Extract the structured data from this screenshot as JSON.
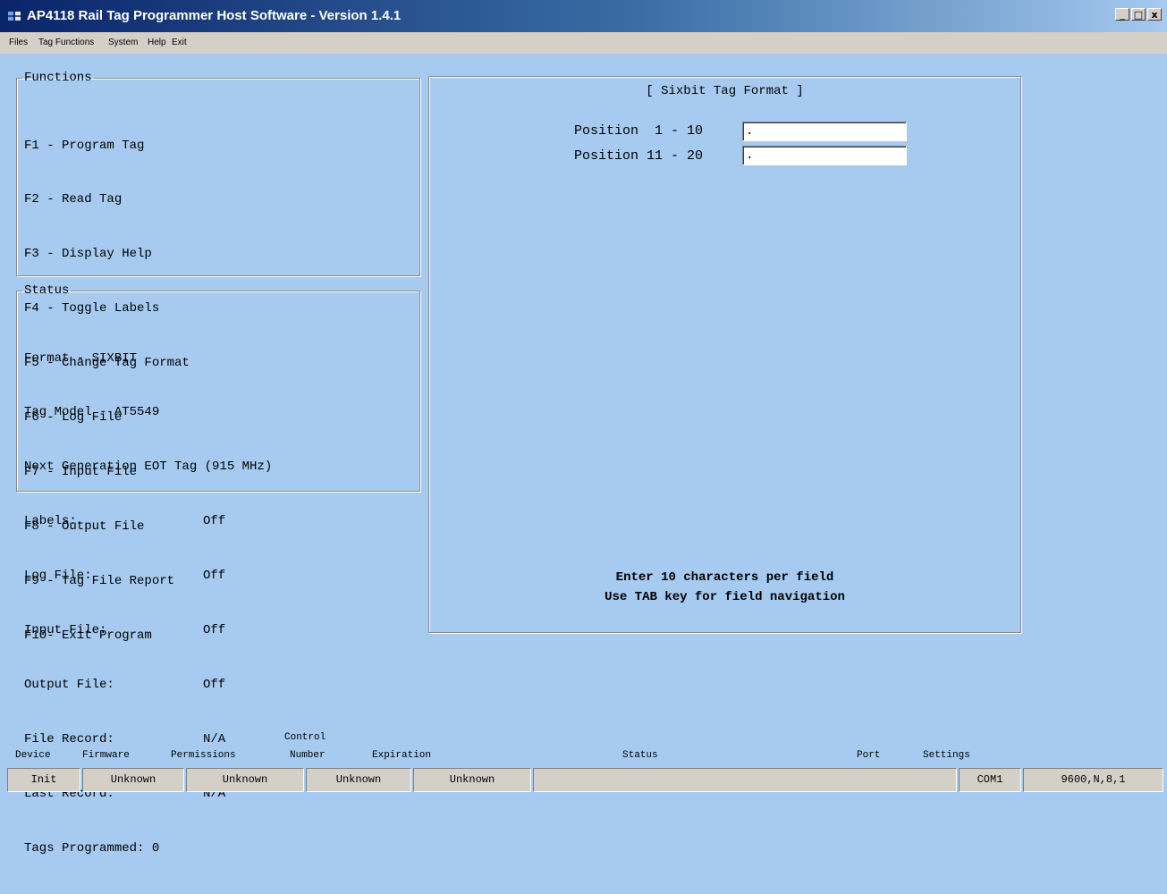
{
  "window": {
    "title": "AP4118 Rail Tag Programmer Host Software - Version 1.4.1",
    "minimize": "_",
    "maximize": "□",
    "close": "x"
  },
  "menu": [
    "Files",
    "Tag Functions",
    "System",
    "Help",
    "Exit"
  ],
  "functions": {
    "legend": "Functions",
    "items": [
      "F1 - Program Tag",
      "F2 - Read Tag",
      "F3 - Display Help",
      "F4 - Toggle Labels",
      "F5 - Change Tag Format",
      "F6 - Log File",
      "F7 - Input File",
      "F8 - Output File",
      "F9 - Tag File Report",
      "F10- Exit Program"
    ]
  },
  "status_panel": {
    "legend": "Status",
    "format": "Format - SIXBIT",
    "tag_model": "Tag Model - AT5549",
    "generation": "Next Generation EOT Tag (915 MHz)",
    "rows": [
      {
        "label": "Labels:",
        "value": "Off"
      },
      {
        "label": "Log File:",
        "value": "Off"
      },
      {
        "label": "Input File:",
        "value": "Off"
      },
      {
        "label": "Output File:",
        "value": "Off"
      },
      {
        "label": "File Record:",
        "value": "N/A"
      },
      {
        "label": "Last Record:",
        "value": "N/A"
      }
    ],
    "tags_programmed": "Tags Programmed: 0"
  },
  "tag_format": {
    "title": "[ Sixbit Tag Format ]",
    "fields": [
      {
        "label": "Position  1 - 10",
        "value": "."
      },
      {
        "label": "Position 11 - 20",
        "value": "."
      }
    ],
    "note1": "Enter 10 characters per field",
    "note2": "Use TAB key for field navigation"
  },
  "statusbar": {
    "headers": {
      "device": "Device",
      "firmware": "Firmware",
      "permissions": "Permissions",
      "control": "Control",
      "number": "Number",
      "expiration": "Expiration",
      "status": "Status",
      "port": "Port",
      "settings": "Settings"
    },
    "cells": {
      "device": "Init",
      "firmware": "Unknown",
      "permissions": "Unknown",
      "control_number": "Unknown",
      "expiration": "Unknown",
      "status": "",
      "port": "COM1",
      "settings": "9600,N,8,1"
    }
  }
}
